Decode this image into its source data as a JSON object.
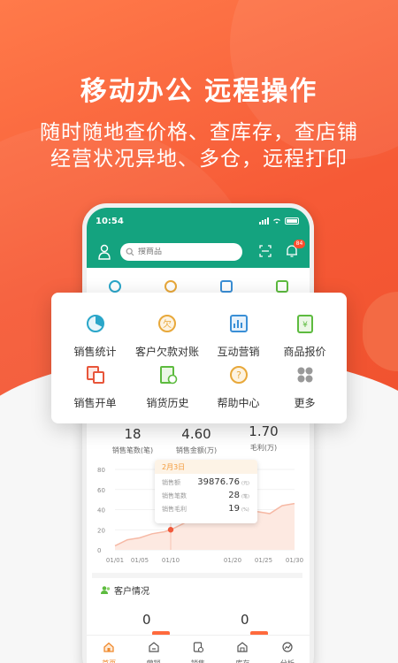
{
  "promo": {
    "headline": "移动办公 远程操作",
    "subline1": "随时随地查价格、查库存，查店铺",
    "subline2": "经营状况异地、多仓，远程打印"
  },
  "status_bar": {
    "time": "10:54"
  },
  "header": {
    "search_placeholder": "搜商品",
    "badge_count": "84"
  },
  "menu": {
    "items": [
      {
        "label": "销售统计",
        "icon": "pie-chart-icon",
        "color": "#2aa6c9"
      },
      {
        "label": "客户欠款对账",
        "icon": "debt-icon",
        "color": "#e8a83a"
      },
      {
        "label": "互动营销",
        "icon": "marketing-icon",
        "color": "#3a8fd6"
      },
      {
        "label": "商品报价",
        "icon": "price-tag-icon",
        "color": "#5dbb3f"
      },
      {
        "label": "销售开单",
        "icon": "bill-icon",
        "color": "#e8553a"
      },
      {
        "label": "销货历史",
        "icon": "history-icon",
        "color": "#5dbb3f"
      },
      {
        "label": "帮助中心",
        "icon": "help-icon",
        "color": "#e8a83a"
      },
      {
        "label": "更多",
        "icon": "more-icon",
        "color": "#888888"
      }
    ]
  },
  "stats": [
    {
      "value": "18",
      "label": "销售笔数(笔)"
    },
    {
      "value": "4.60",
      "label": "销售金额(万)"
    },
    {
      "value": "1.70",
      "label": "毛利(万)"
    }
  ],
  "tooltip": {
    "date": "2月3日",
    "rows": [
      {
        "label": "销售额",
        "value": "39876.76",
        "unit": "(元)"
      },
      {
        "label": "销售笔数",
        "value": "28",
        "unit": "(笔)"
      },
      {
        "label": "销售毛利",
        "value": "19",
        "unit": "(%)"
      }
    ]
  },
  "chart_data": {
    "type": "area",
    "x": [
      "01/01",
      "01/05",
      "01/10",
      "01/20",
      "01/25",
      "01/30"
    ],
    "yticks": [
      "80",
      "60",
      "40",
      "20",
      "0"
    ],
    "ylim": [
      0,
      80
    ],
    "series": [
      {
        "x_days": [
          1,
          3,
          5,
          7,
          9,
          10,
          12,
          14,
          16,
          18,
          20,
          22,
          24,
          26,
          28,
          30
        ],
        "values": [
          4,
          10,
          12,
          16,
          18,
          20,
          26,
          33,
          38,
          40,
          44,
          42,
          38,
          36,
          44,
          46
        ]
      }
    ],
    "highlight": {
      "x": 10,
      "y": 20
    },
    "colors": {
      "line": "#f6b9a5",
      "fill": "#fde9e1",
      "point": "#f25a3c"
    }
  },
  "customer": {
    "title": "客户情况",
    "values": [
      "0",
      "0"
    ]
  },
  "tabbar": {
    "items": [
      {
        "label": "首页",
        "icon": "home-icon"
      },
      {
        "label": "营销",
        "icon": "marketing-tab-icon"
      },
      {
        "label": "销售",
        "icon": "sales-tab-icon"
      },
      {
        "label": "库存",
        "icon": "inventory-tab-icon"
      },
      {
        "label": "分析",
        "icon": "analysis-tab-icon"
      }
    ],
    "active_color": "#f08a2e"
  }
}
